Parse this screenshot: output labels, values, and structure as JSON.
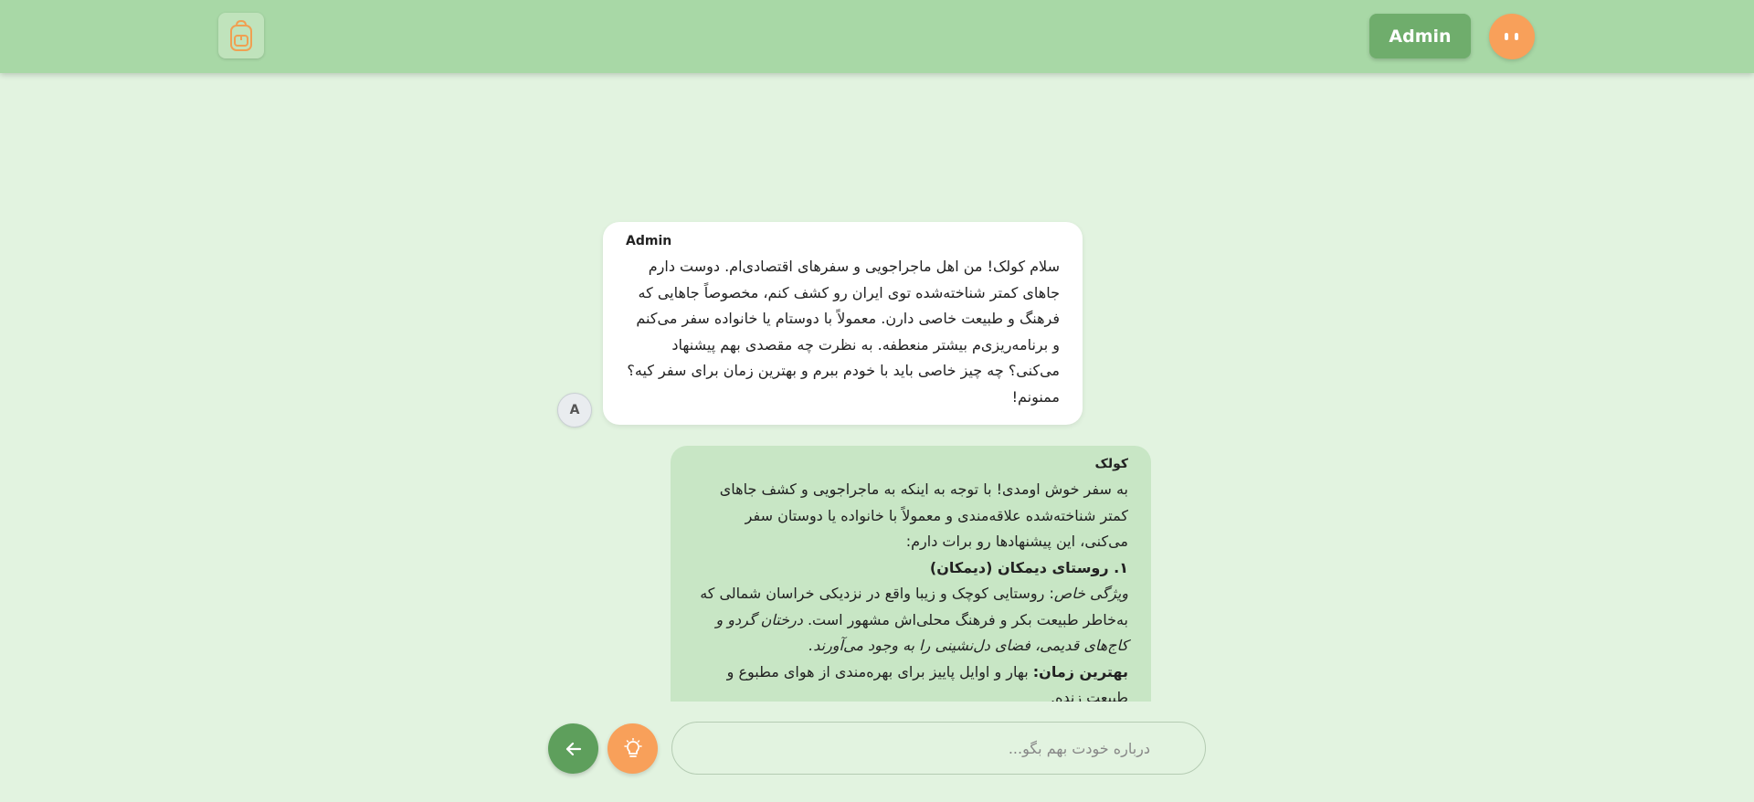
{
  "header": {
    "admin_label": "Admin"
  },
  "icons": {
    "logo": "backpack-icon",
    "mascot": "mascot-face-icon",
    "send": "arrow-left-icon",
    "idea": "lightbulb-icon"
  },
  "colors": {
    "header_bg": "#a8d8a6",
    "page_bg": "#e2f3e0",
    "accent_green": "#6fad6c",
    "accent_orange": "#f8a05a",
    "bot_bubble": "#c8e6c5",
    "user_bubble": "#ffffff"
  },
  "messages": [
    {
      "sender": "Admin",
      "avatar_initial": "A",
      "text": "سلام کولک! من اهل ماجراجویی و سفرهای اقتصادی‌ام. دوست دارم جاهای کمتر شناخته‌شده توی ایران رو کشف کنم، مخصوصاً جاهایی که فرهنگ و طبیعت خاصی دارن. معمولاً با دوستام یا خانواده سفر می‌کنم و برنامه‌ریزی‌م بیشتر منعطفه. به نظرت چه مقصدی بهم پیشنهاد می‌کنی؟ چه چیز خاصی باید با خودم ببرم و بهترین زمان برای سفر کیه؟ ممنونم!"
    },
    {
      "sender": "کولک",
      "intro": "به سفر خوش اومدی! با توجه به اینکه به ماجراجویی و کشف جاهای کمتر شناخته‌شده علاقه‌مندی و معمولاً با خانواده یا دوستان سفر می‌کنی، این پیشنهادها رو برات دارم:",
      "section_title": "۱. روستای دیمکان (دیمکان)",
      "feature_label": "ویژگی خاص",
      "feature_text": ": روستایی کوچک و زیبا واقع در نزدیکی خراسان شمالی که به‌خاطر طبیعت بکر و فرهنگ محلی‌اش مشهور است. ",
      "feature_italic": "درختان گردو و کاج‌های قدیمی، فضای دل‌نشینی را به وجود می‌آورند.",
      "time_label": "بهترین زمان:",
      "time_text": " بهار و اوایل پاییز برای بهره‌مندی از هوای مطبوع و طبیعت زنده."
    }
  ],
  "input": {
    "placeholder": "درباره خودت بهم بگو..."
  }
}
